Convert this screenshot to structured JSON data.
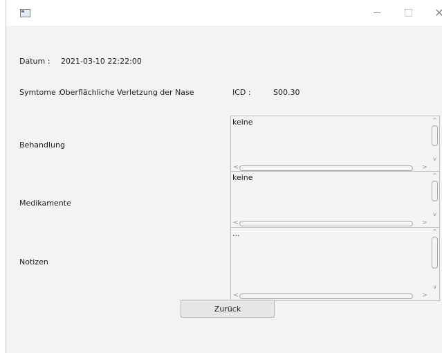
{
  "window": {
    "icon": "app-window-icon",
    "controls": {
      "minimize": "—",
      "maximize": "□",
      "close": "✕"
    }
  },
  "fields": {
    "datum_label": "Datum :",
    "datum_value": "2021-03-10 22:22:00",
    "symptome_label": "Symtome :",
    "symptome_value": "Oberflächliche Verletzung der Nase",
    "icd_label": "ICD :",
    "icd_value": "S00.30",
    "behandlung_label": "Behandlung",
    "behandlung_text": "keine",
    "medikamente_label": "Medikamente",
    "medikamente_text": "keine",
    "notizen_label": "Notizen",
    "notizen_text": "..."
  },
  "buttons": {
    "back_label": "Zurück"
  },
  "scrollbar_glyphs": {
    "up": "^",
    "down": "v",
    "left": "<",
    "right": ">"
  }
}
